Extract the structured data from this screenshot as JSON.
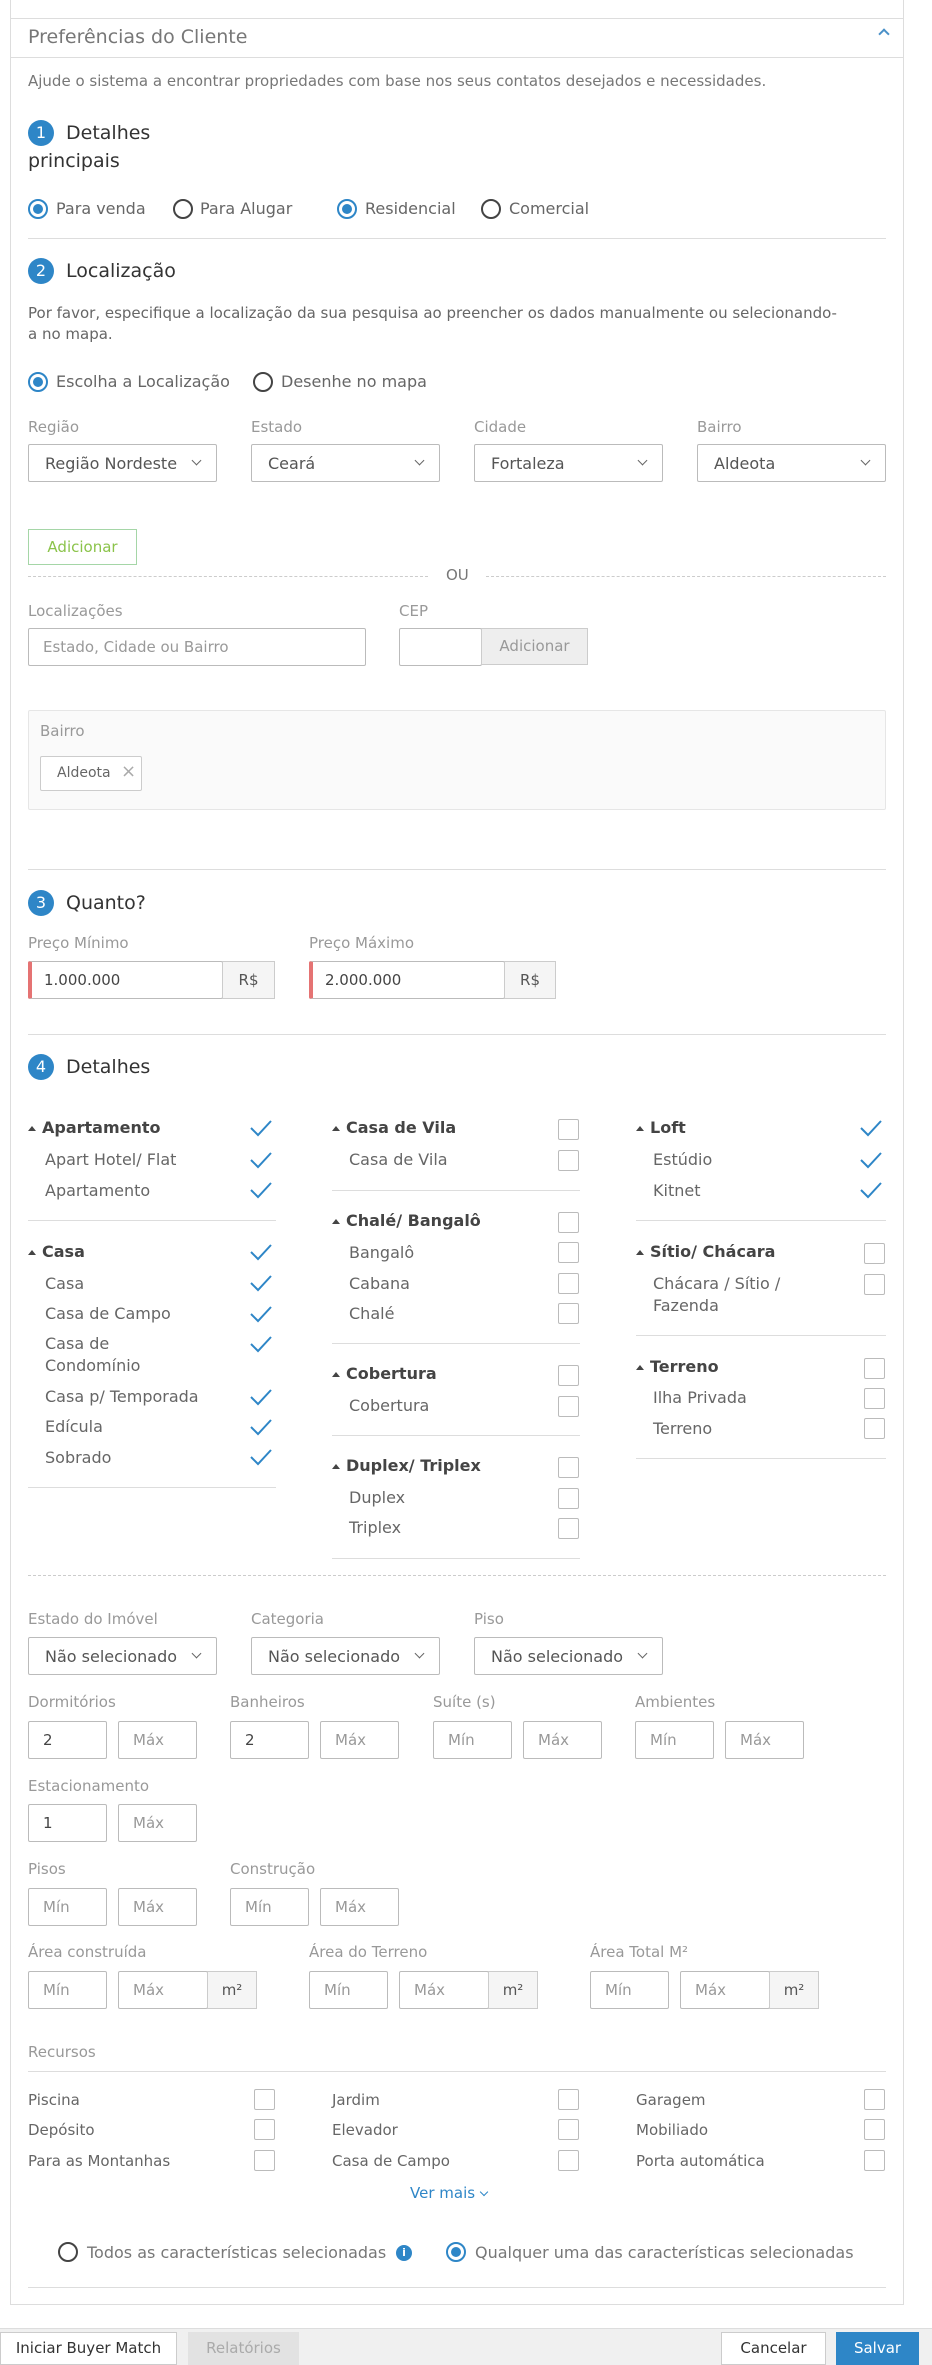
{
  "panel": {
    "title": "Preferências do Cliente",
    "intro": "Ajude o sistema a encontrar propriedades com base nos seus contatos desejados e necessidades."
  },
  "s1": {
    "num": "1",
    "title_line1": "Detalhes",
    "title_line2": "principais",
    "options": [
      "Para venda",
      "Para Alugar",
      "Residencial",
      "Comercial"
    ]
  },
  "s2": {
    "num": "2",
    "title": "Localização",
    "desc_line1": "Por favor, especifique a localização da sua pesquisa ao preencher os dados manualmente ou selecionando-",
    "desc_line2": "a no mapa.",
    "mode1": "Escolha a Localização",
    "mode2": "Desenhe no mapa",
    "regiao_label": "Região",
    "regiao": "Região Nordeste",
    "estado_label": "Estado",
    "estado": "Ceará",
    "cidade_label": "Cidade",
    "cidade": "Fortaleza",
    "bairro_label": "Bairro",
    "bairro": "Aldeota",
    "add": "Adicionar",
    "ou": "OU",
    "locs_label": "Localizações",
    "locs_ph": "Estado, Cidade ou Bairro",
    "cep_label": "CEP",
    "cep_add": "Adicionar",
    "box_label": "Bairro",
    "tag": "Aldeota",
    "tag_x": "×"
  },
  "s3": {
    "num": "3",
    "title": "Quanto?",
    "min_label": "Preço Mínimo",
    "min": "1.000.000",
    "max_label": "Preço Máximo",
    "max": "2.000.000",
    "cur": "R$"
  },
  "s4": {
    "num": "4",
    "title": "Detalhes",
    "g_apto": "Apartamento",
    "apto1": "Apart Hotel/ Flat",
    "apto2": "Apartamento",
    "g_casa": "Casa",
    "casa1": "Casa",
    "casa2": "Casa de Campo",
    "casa3a": "Casa de",
    "casa3b": "Condomínio",
    "casa4": "Casa p/ Temporada",
    "casa5": "Edícula",
    "casa6": "Sobrado",
    "g_vila": "Casa de Vila",
    "vila1": "Casa de Vila",
    "g_chale": "Chalé/ Bangalô",
    "chale1": "Bangalô",
    "chale2": "Cabana",
    "chale3": "Chalé",
    "g_cob": "Cobertura",
    "cob1": "Cobertura",
    "g_dup": "Duplex/ Triplex",
    "dup1": "Duplex",
    "dup2": "Triplex",
    "g_loft": "Loft",
    "loft1": "Estúdio",
    "loft2": "Kitnet",
    "g_sitio": "Sítio/ Chácara",
    "sitio1a": "Chácara / Sítio /",
    "sitio1b": "Fazenda",
    "g_terr": "Terreno",
    "terr1": "Ilha Privada",
    "terr2": "Terreno"
  },
  "filters": {
    "estado_label": "Estado do Imóvel",
    "cat_label": "Categoria",
    "piso_label": "Piso",
    "ns": "Não selecionado",
    "dorm": "Dormitórios",
    "banh": "Banheiros",
    "suite": "Suíte (s)",
    "amb": "Ambientes",
    "estac": "Estacionamento",
    "pisos": "Pisos",
    "constr": "Construção",
    "area_c": "Área construída",
    "area_t": "Área do Terreno",
    "area_tot": "Área Total M²",
    "m2": "m²",
    "min": "Mín",
    "max": "Máx",
    "dorm_min": "2",
    "banh_min": "2",
    "estac_min": "1"
  },
  "recursos": {
    "title": "Recursos",
    "items": [
      "Piscina",
      "Jardim",
      "Garagem",
      "Depósito",
      "Elevador",
      "Mobiliado",
      "Para as Montanhas",
      "Casa de Campo",
      "Porta automática"
    ],
    "more": "Ver mais",
    "opt_all": "Todos as características selecionadas",
    "opt_any": "Qualquer uma das características selecionadas",
    "info": "i"
  },
  "footer": {
    "buyer": "Iniciar Buyer Match",
    "rel": "Relatórios",
    "cancel": "Cancelar",
    "save": "Salvar"
  }
}
